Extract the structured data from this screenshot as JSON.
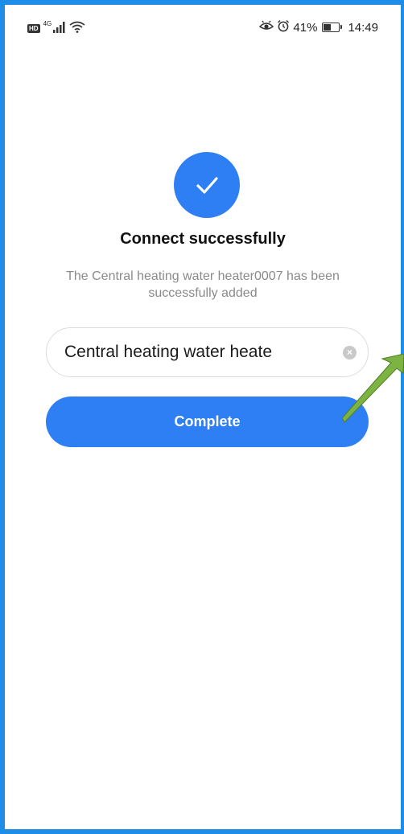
{
  "status_bar": {
    "hd": "HD",
    "network": "4G",
    "battery_percent": "41%",
    "battery_level": 0.41,
    "time": "14:49",
    "icons": [
      "signal-icon",
      "wifi-icon",
      "eye-icon",
      "alarm-icon",
      "battery-icon"
    ]
  },
  "success": {
    "icon": "check-icon",
    "title": "Connect successfully",
    "message": "The Central heating water heater0007 has been successfully added"
  },
  "name_field": {
    "value": "Central heating water heate",
    "clear_icon": "clear-icon"
  },
  "complete_button": {
    "label": "Complete"
  },
  "colors": {
    "accent": "#2f7ff4",
    "frame": "#1e8de8",
    "annotation_arrow": "#7cb342"
  }
}
